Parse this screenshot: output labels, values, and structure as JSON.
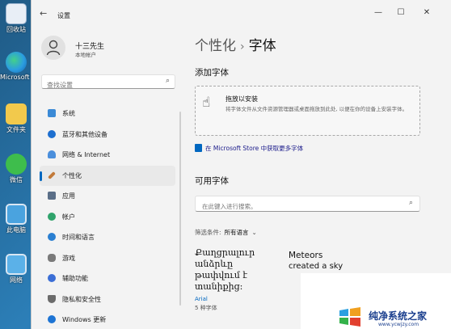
{
  "desktop": {
    "icons": [
      {
        "label": "回收站",
        "color": "#e8eef6"
      },
      {
        "label": "Microsoft Edge",
        "color": "#2b9de0"
      },
      {
        "label": "文件夹",
        "color": "#f2c94c"
      },
      {
        "label": "微信",
        "color": "#3ebd4c"
      },
      {
        "label": "此电脑",
        "color": "#4aa3df"
      },
      {
        "label": "网络",
        "color": "#5bb1e8"
      }
    ]
  },
  "window": {
    "title": "设置",
    "controls": {
      "minimize": "—",
      "maximize": "☐",
      "close": "✕"
    }
  },
  "sidebar": {
    "user_name": "十三先生",
    "account_type": "本地帐户",
    "search_placeholder": "查找设置",
    "items": [
      {
        "label": "系统",
        "icon": "monitor-icon",
        "color": "#3b8ad6"
      },
      {
        "label": "蓝牙和其他设备",
        "icon": "bluetooth-icon",
        "color": "#1d6fcf"
      },
      {
        "label": "网络 & Internet",
        "icon": "wifi-icon",
        "color": "#4b8fdc"
      },
      {
        "label": "个性化",
        "icon": "brush-icon",
        "color": "#c27a3a"
      },
      {
        "label": "应用",
        "icon": "apps-icon",
        "color": "#5a6e87"
      },
      {
        "label": "帐户",
        "icon": "person-icon",
        "color": "#2fa36b"
      },
      {
        "label": "时间和语言",
        "icon": "globe-clock-icon",
        "color": "#2a7fd1"
      },
      {
        "label": "游戏",
        "icon": "gamepad-icon",
        "color": "#7a7a7a"
      },
      {
        "label": "辅助功能",
        "icon": "accessibility-icon",
        "color": "#3b6ed6"
      },
      {
        "label": "隐私和安全性",
        "icon": "shield-icon",
        "color": "#6b6b6b"
      },
      {
        "label": "Windows 更新",
        "icon": "update-icon",
        "color": "#1d74d4"
      }
    ]
  },
  "main": {
    "breadcrumb_parent": "个性化",
    "breadcrumb_sep": "›",
    "breadcrumb_current": "字体",
    "add_heading": "添加字体",
    "drop_title": "拖放以安装",
    "drop_desc": "将字体文件从文件资源管理器或桌面拖放到此处, 以便在你的设备上安装字体。",
    "store_link": "在 Microsoft Store 中获取更多字体",
    "available_heading": "可用字体",
    "font_search_placeholder": "在此键入进行搜索。",
    "filter_label": "筛选条件:",
    "filter_value": "所有语言",
    "font_cards": [
      {
        "sample": "Քաղցրալուր անձրևը թափվում է տանիքից:",
        "name": "Arial",
        "count": "5 种字体"
      },
      {
        "name": "Meteors",
        "sample": "created a sky"
      }
    ]
  },
  "watermark": {
    "name": "纯净系统之家",
    "url": "www.ycwjzy.com"
  }
}
